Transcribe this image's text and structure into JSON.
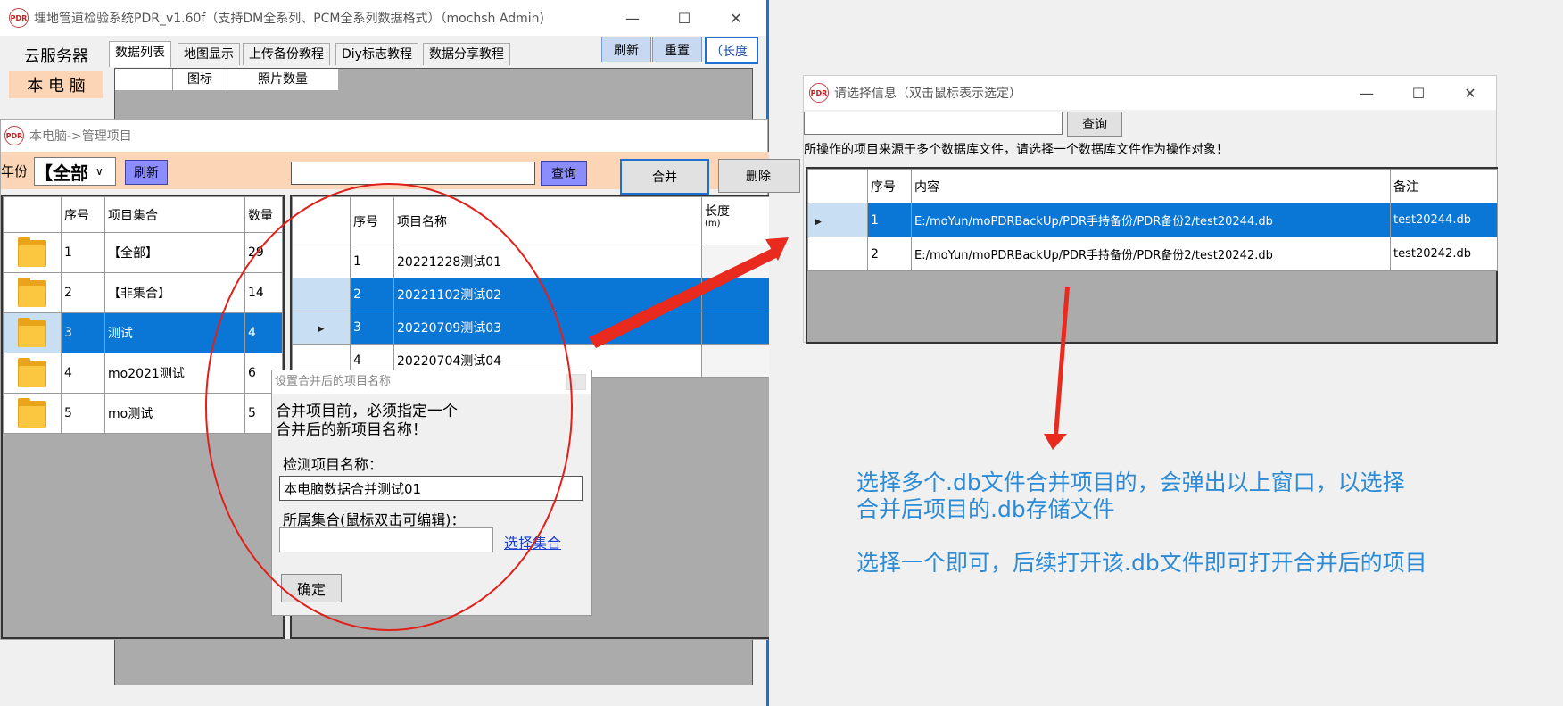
{
  "main_window": {
    "title": "埋地管道检验系统PDR_v1.60f（支持DM全系列、PCM全系列数据格式）（mochsh Admin)",
    "minimize": "—",
    "maximize": "☐",
    "close": "✕",
    "side_nav": [
      "云服务器",
      "本 电 脑"
    ],
    "tabs": [
      "数据列表",
      "地图显示",
      "上传备份教程",
      "Diy标志教程",
      "数据分享教程"
    ],
    "toolbar": {
      "refresh": "刷新",
      "reset": "重置",
      "long": "（长度"
    },
    "bg_table_headers": [
      "图标",
      "照片数量"
    ]
  },
  "manage_window": {
    "title": "本电脑->管理项目",
    "year_label": "年份",
    "year_value": "【全部",
    "refresh": "刷新",
    "query": "查询",
    "merge": "合并",
    "delete": "删除",
    "search_value": "",
    "collections": {
      "headers": [
        "序号",
        "项目集合",
        "数量"
      ],
      "rows": [
        {
          "no": "1",
          "name": "【全部】",
          "count": "29",
          "selected": false
        },
        {
          "no": "2",
          "name": "【非集合】",
          "count": "14",
          "selected": false
        },
        {
          "no": "3",
          "name": "测试",
          "count": "4",
          "selected": true
        },
        {
          "no": "4",
          "name": "mo2021测试",
          "count": "6",
          "selected": false
        },
        {
          "no": "5",
          "name": "mo测试",
          "count": "5",
          "selected": false
        }
      ]
    },
    "projects": {
      "headers": [
        "序号",
        "项目名称",
        "长度",
        "(m)"
      ],
      "rows": [
        {
          "no": "1",
          "name": "20221228测试01",
          "selected": false
        },
        {
          "no": "2",
          "name": "20221102测试02",
          "selected": true
        },
        {
          "no": "3",
          "name": "20220709测试03",
          "selected": true
        },
        {
          "no": "4",
          "name": "20220704测试04",
          "selected": false
        }
      ]
    }
  },
  "merge_dialog": {
    "title": "设置合并后的项目名称",
    "message_line1": "合并项目前，必须指定一个",
    "message_line2": "合并后的新项目名称！",
    "name_label": "检测项目名称：",
    "name_value": "本电脑数据合并测试01",
    "collection_label": "所属集合(鼠标双击可编辑)：",
    "collection_value": "",
    "select_link": "选择集合",
    "ok": "确定"
  },
  "select_window": {
    "title": "请选择信息（双击鼠标表示选定）",
    "query": "查询",
    "search_value": "",
    "hint": "所操作的项目来源于多个数据库文件，请选择一个数据库文件作为操作对象！",
    "headers": [
      "序号",
      "内容",
      "备注"
    ],
    "rows": [
      {
        "no": "1",
        "content": "E:/moYun/moPDRBackUp/PDR手持备份/PDR备份2/test20244.db",
        "note": "test20244.db",
        "selected": true
      },
      {
        "no": "2",
        "content": "E:/moYun/moPDRBackUp/PDR手持备份/PDR备份2/test20242.db",
        "note": "test20242.db",
        "selected": false
      }
    ]
  },
  "annotation": {
    "line1": "选择多个.db文件合并项目的，会弹出以上窗口，以选择",
    "line2": "合并后项目的.db存储文件",
    "line3": "选择一个即可，后续打开该.db文件即可打开合并后的项目"
  },
  "icons": {
    "app": "pdr-logo-icon",
    "folder": "folder-icon",
    "row_pointer": "row-pointer-icon"
  },
  "colors": {
    "selection": "#0a76d6",
    "annotation_text": "#2d8bd6",
    "highlight_circle": "#e0201a",
    "arrow": "#e82a1f"
  }
}
